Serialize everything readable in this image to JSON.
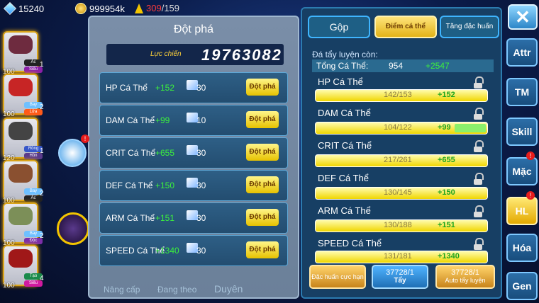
{
  "resources": {
    "gems": "15240",
    "coins": "999954k",
    "energy_current": "309",
    "energy_max": "/159"
  },
  "team": [
    {
      "level": "100",
      "count": "1",
      "tag1": "Ác",
      "tag2": "Siêu",
      "color": "#6e2b3f"
    },
    {
      "level": "100",
      "count": "2",
      "tag1": "Bay",
      "tag2": "Lửa",
      "color": "#c72525"
    },
    {
      "level": "120",
      "count": "1",
      "tag1": "Rồng",
      "tag2": "Hồn",
      "color": "#444"
    },
    {
      "level": "100",
      "count": "2",
      "tag1": "Bay",
      "tag2": "Ác",
      "color": "#8a5030"
    },
    {
      "level": "100",
      "count": "2",
      "tag1": "Bay",
      "tag2": "Độc",
      "color": "#7c8f58"
    },
    {
      "level": "100",
      "count": "4",
      "tag1": "Tạo",
      "tag2": "Siêu",
      "color": "#a01818"
    }
  ],
  "breakthrough": {
    "title": "Đột phá",
    "power_label": "Lực chiến",
    "power_value": "19763082",
    "rows": [
      {
        "name": "HP Cá Thể",
        "plus": "+152",
        "cost": "30",
        "button": "Đột phá"
      },
      {
        "name": "DAM Cá Thể",
        "plus": "+99",
        "cost": "10",
        "button": "Đột phá"
      },
      {
        "name": "CRIT Cá Thể",
        "plus": "+655",
        "cost": "30",
        "button": "Đột phá"
      },
      {
        "name": "DEF Cá Thể",
        "plus": "+150",
        "cost": "30",
        "button": "Đột phá"
      },
      {
        "name": "ARM Cá Thể",
        "plus": "+151",
        "cost": "30",
        "button": "Đột phá"
      },
      {
        "name": "SPEED Cá Thể",
        "plus": "+1340",
        "cost": "30",
        "button": "Đột phá"
      }
    ],
    "bottom_tabs": [
      "Nâng cấp",
      "Đang theo",
      "Duyên"
    ]
  },
  "right_panel": {
    "tabs": [
      "Gộp",
      "Điểm cá thể",
      "Tăng đặc huấn"
    ],
    "wash_label": "Đá tẩy luyện còn:",
    "total_label": "Tổng Cá Thể:",
    "total_value": "954",
    "total_plus": "+2547",
    "stats": [
      {
        "name": "HP Cá Thể",
        "value": "142/153",
        "plus": "+152",
        "green": 0
      },
      {
        "name": "DAM Cá Thể",
        "value": "104/122",
        "plus": "+99",
        "green": 0.18
      },
      {
        "name": "CRIT Cá Thể",
        "value": "217/261",
        "plus": "+655",
        "green": 0
      },
      {
        "name": "DEF Cá Thể",
        "value": "130/145",
        "plus": "+150",
        "green": 0
      },
      {
        "name": "ARM Cá Thể",
        "value": "130/188",
        "plus": "+151",
        "green": 0
      },
      {
        "name": "SPEED Cá Thể",
        "value": "131/181",
        "plus": "+1340",
        "green": 0
      }
    ],
    "buttons": {
      "special": "Đặc huấn cực hạn",
      "wash_count": "37728/1",
      "wash": "Tẩy",
      "auto_count": "37728/1",
      "auto": "Auto tẩy luyện"
    }
  },
  "side_menu": [
    "Attr",
    "TM",
    "Skill",
    "Mặc",
    "HL",
    "Hóa",
    "Gen"
  ],
  "badge": "!"
}
